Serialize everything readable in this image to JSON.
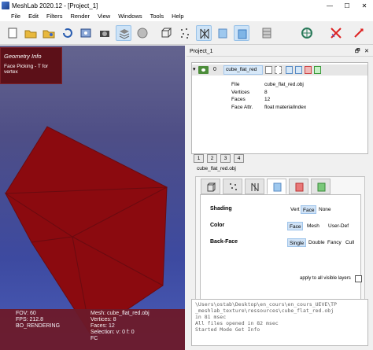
{
  "window": {
    "title": "MeshLab 2020.12 - [Project_1]",
    "controls": [
      "—",
      "☐",
      "✕"
    ]
  },
  "menu": [
    "File",
    "Edit",
    "Filters",
    "Render",
    "View",
    "Windows",
    "Tools",
    "Help"
  ],
  "toolbar": {
    "icons": [
      "new-project-icon",
      "open-icon",
      "open-mesh-icon",
      "reload-icon",
      "save-snapshot-icon",
      "camera-icon",
      "layers-icon",
      "raster-icon",
      "bounding-box-icon",
      "points-icon",
      "wireframe-icon",
      "flat-icon",
      "smooth-icon",
      "texture-icon",
      "select-icon",
      "no-select-icon",
      "transform-icon",
      "navigate-icon"
    ]
  },
  "viewport": {
    "geometry_info": {
      "title": "Geometry Info",
      "text": "Face Picking - T for vertex"
    },
    "cube_color": "#8b0a0f",
    "stats": {
      "fov": "FOV: 60",
      "fps": "FPS:   212.8",
      "rendering": "BO_RENDERING",
      "mesh": "Mesh: cube_flat_red.obj",
      "vertices": "Vertices: 8",
      "faces": "Faces: 12",
      "selection": "Selection: v: 0 f: 0",
      "fc": "FC"
    }
  },
  "layers": {
    "panel_title": "Project_1",
    "panel_controls": [
      "🗗",
      "✕"
    ],
    "index": "0",
    "name": "cube_flat_red",
    "details": [
      {
        "key": "File",
        "value": "cube_flat_red.obj"
      },
      {
        "key": "Vertices",
        "value": "8"
      },
      {
        "key": "Faces",
        "value": "12"
      },
      {
        "key": "Face Attr.",
        "value": "float materialIndex"
      }
    ]
  },
  "view_buttons": [
    "1",
    "2",
    "3",
    "4"
  ],
  "decoration": {
    "mesh_label": "cube_flat_red.obj",
    "shading": {
      "label": "Shading",
      "options": [
        "Vert",
        "Face",
        "None"
      ],
      "selected": "Face"
    },
    "color": {
      "label": "Color",
      "options": [
        "Face",
        "Mesh",
        "User-Def"
      ],
      "selected": "Face"
    },
    "backface": {
      "label": "Back-Face",
      "options": [
        "Single",
        "Double",
        "Fancy",
        "Cull"
      ],
      "selected": "Single"
    },
    "apply_label": "apply to all visible layers"
  },
  "log": [
    "\\Users\\ostab\\Desktop\\en_cours\\en_cours_UEVE\\TP",
    "_meshlab_texture\\ressources\\cube_flat_red.obj",
    " in 81 msec",
    "All files opened in 82 msec",
    "Started Mode Get Info"
  ]
}
